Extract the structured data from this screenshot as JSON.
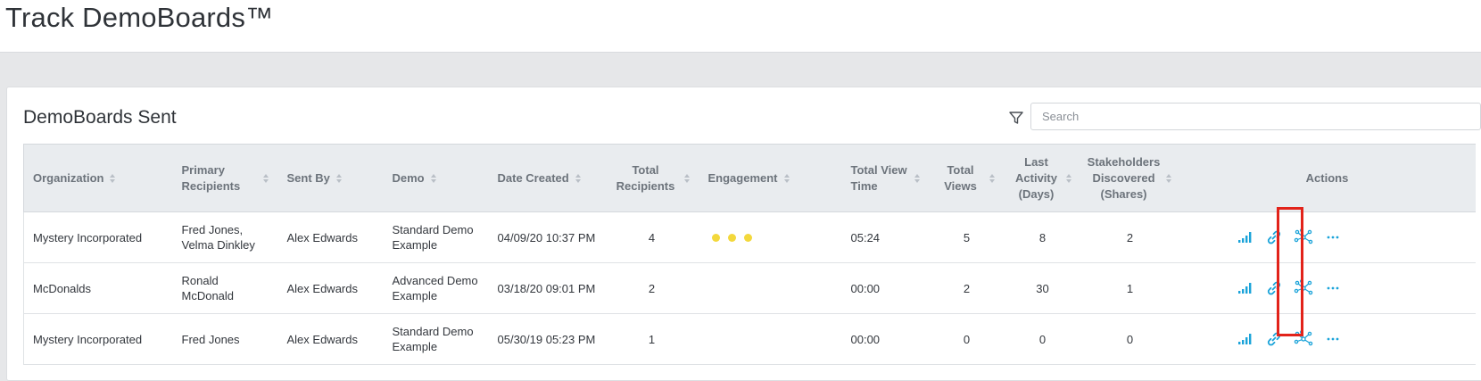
{
  "app": {
    "title": "Track DemoBoards™"
  },
  "card": {
    "title": "DemoBoards Sent",
    "search_placeholder": "Search"
  },
  "columns": [
    {
      "label": "Organization"
    },
    {
      "label": "Primary Recipients"
    },
    {
      "label": "Sent By"
    },
    {
      "label": "Demo"
    },
    {
      "label": "Date Created"
    },
    {
      "label": "Total Recipients"
    },
    {
      "label": "Engagement"
    },
    {
      "label": "Total View Time"
    },
    {
      "label": "Total Views"
    },
    {
      "label": "Last Activity (Days)"
    },
    {
      "label": "Stakeholders Discovered (Shares)"
    },
    {
      "label": "Actions"
    }
  ],
  "rows": [
    {
      "organization": "Mystery Incorporated",
      "primary_recipients": "Fred Jones, Velma Dinkley",
      "sent_by": "Alex Edwards",
      "demo": "Standard Demo Example",
      "date_created": "04/09/20 10:37 PM",
      "total_recipients": "4",
      "engagement_level": 3,
      "total_view_time": "05:24",
      "total_views": "5",
      "last_activity": "8",
      "stakeholders": "2"
    },
    {
      "organization": "McDonalds",
      "primary_recipients": "Ronald McDonald",
      "sent_by": "Alex Edwards",
      "demo": "Advanced Demo Example",
      "date_created": "03/18/20 09:01 PM",
      "total_recipients": "2",
      "engagement_level": 0,
      "total_view_time": "00:00",
      "total_views": "2",
      "last_activity": "30",
      "stakeholders": "1"
    },
    {
      "organization": "Mystery Incorporated",
      "primary_recipients": "Fred Jones",
      "sent_by": "Alex Edwards",
      "demo": "Standard Demo Example",
      "date_created": "05/30/19 05:23 PM",
      "total_recipients": "1",
      "engagement_level": 0,
      "total_view_time": "00:00",
      "total_views": "0",
      "last_activity": "0",
      "stakeholders": "0"
    }
  ],
  "icons": {
    "analytics": "bar-chart-icon",
    "link": "link-icon",
    "stakeholder_map": "network-icon",
    "more": "more-icon",
    "filter": "filter-icon"
  },
  "colors": {
    "accent": "#1aa3d9",
    "engagement_dot": "#f3d83c",
    "highlight": "#e2231a",
    "header_bg": "#e9ecef"
  }
}
